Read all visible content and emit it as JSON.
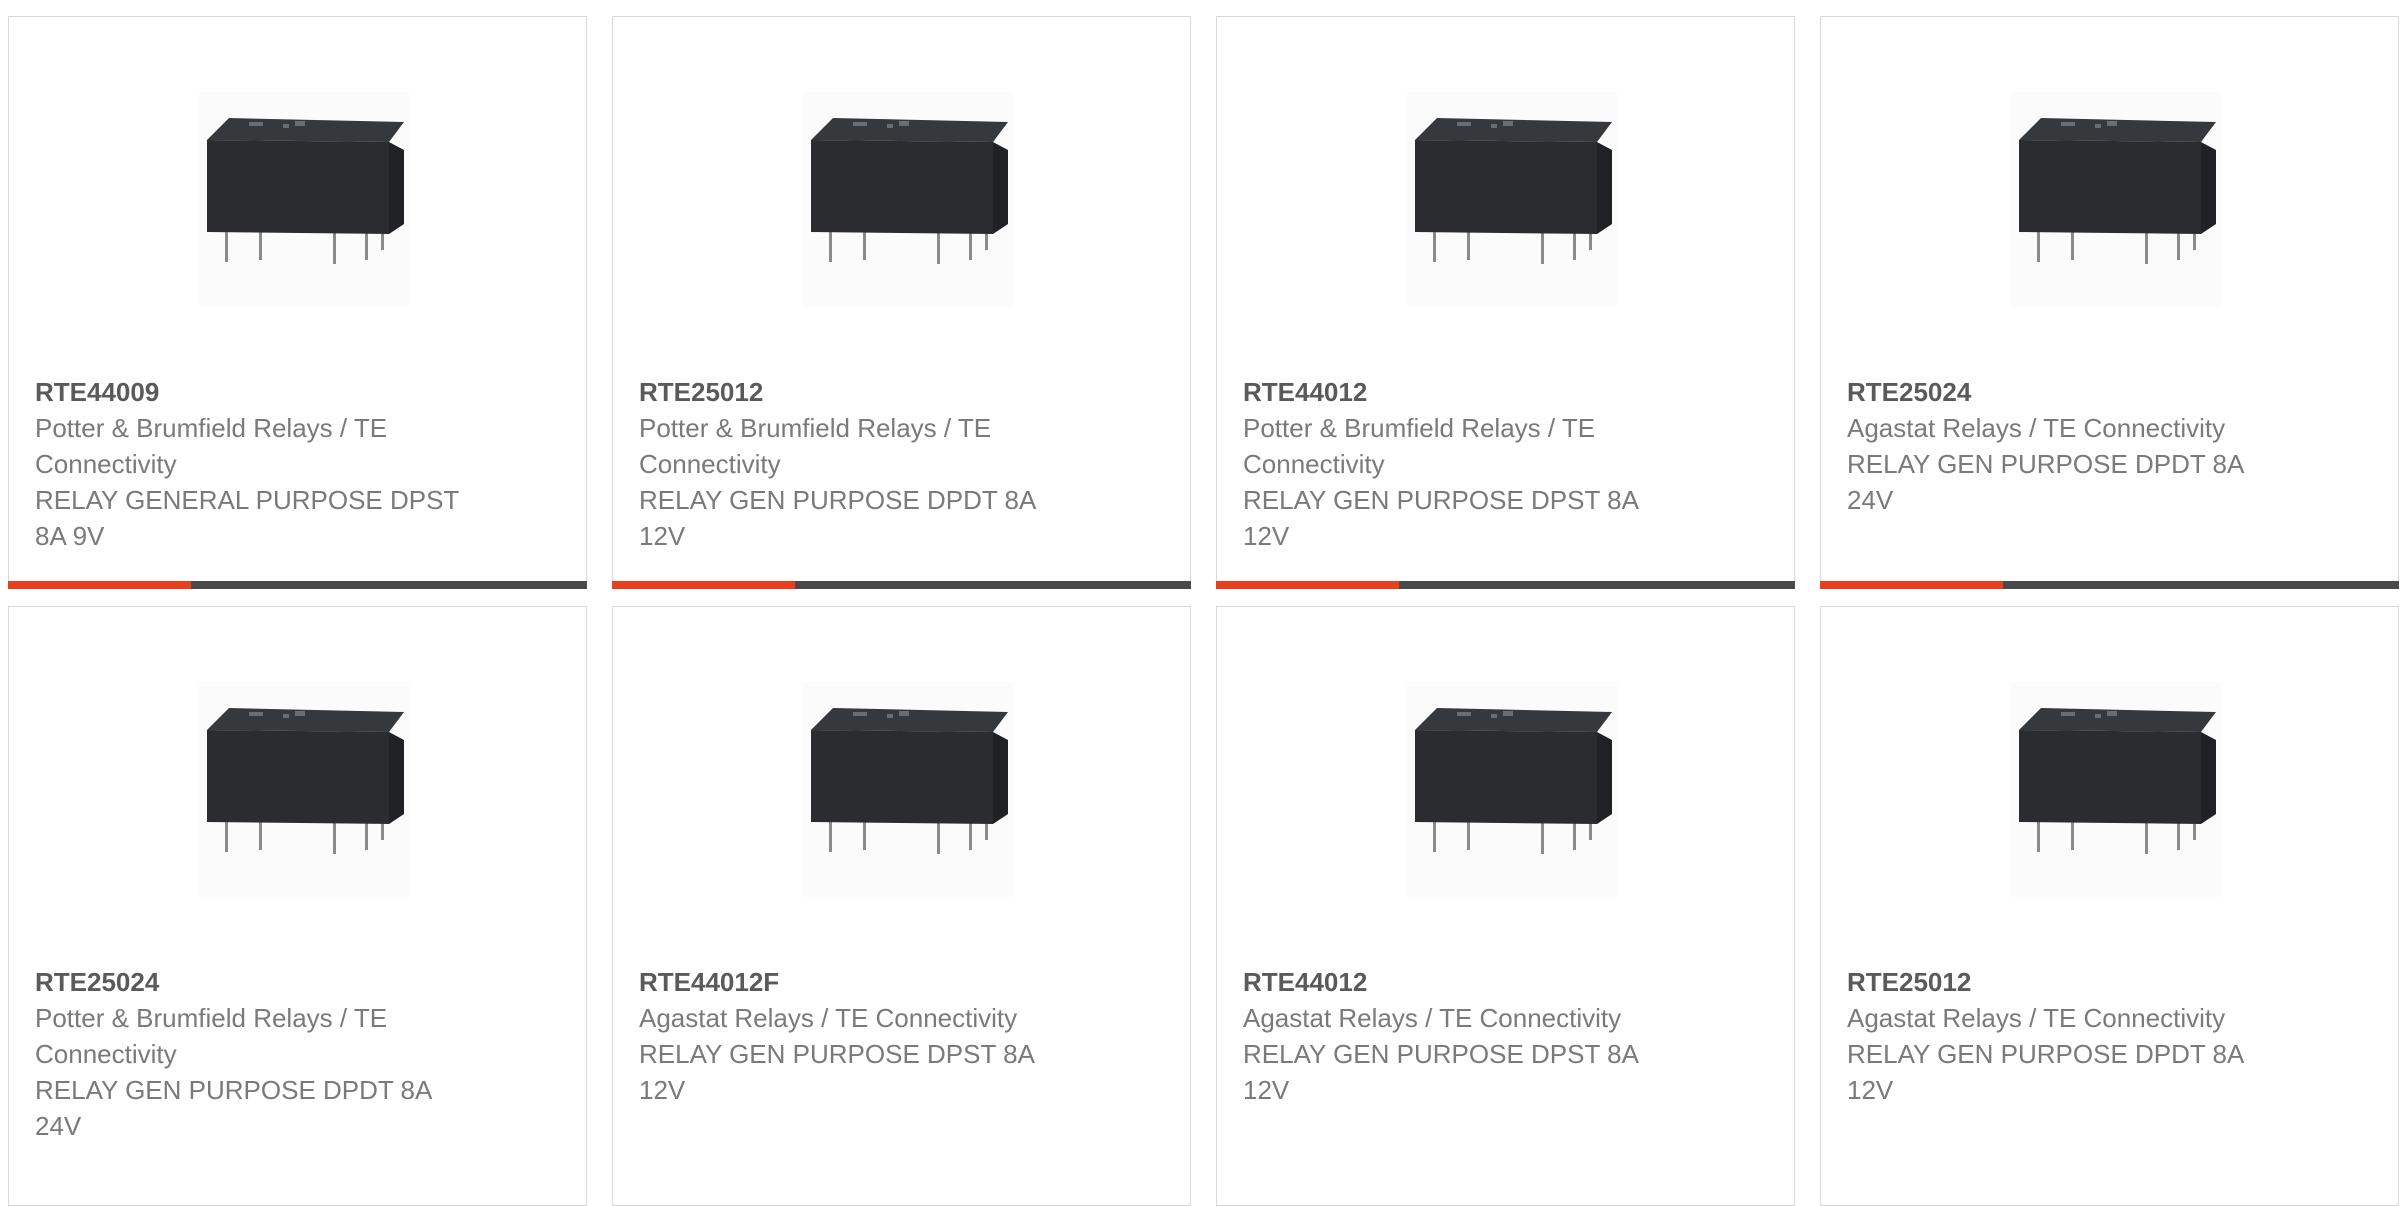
{
  "colors": {
    "accent": "#e8401c",
    "bar": "#4a4a4a",
    "border": "#d9d9d9",
    "title_text": "#5a5a5a",
    "body_text": "#7a7a7a"
  },
  "products": [
    {
      "part_number": "RTE44009",
      "manufacturer": "Potter & Brumfield Relays / TE Connectivity",
      "description": "RELAY GENERAL PURPOSE DPST 8A 9V",
      "image_icon": "relay-product-image"
    },
    {
      "part_number": "RTE25012",
      "manufacturer": "Potter & Brumfield Relays / TE Connectivity",
      "description": "RELAY GEN PURPOSE DPDT 8A 12V",
      "image_icon": "relay-product-image"
    },
    {
      "part_number": "RTE44012",
      "manufacturer": "Potter & Brumfield Relays / TE Connectivity",
      "description": "RELAY GEN PURPOSE DPST 8A 12V",
      "image_icon": "relay-product-image"
    },
    {
      "part_number": "RTE25024",
      "manufacturer": "Agastat Relays / TE Connectivity",
      "description": "RELAY GEN PURPOSE DPDT 8A 24V",
      "image_icon": "relay-product-image"
    },
    {
      "part_number": "RTE25024",
      "manufacturer": "Potter & Brumfield Relays / TE Connectivity",
      "description": "RELAY GEN PURPOSE DPDT 8A 24V",
      "image_icon": "relay-product-image"
    },
    {
      "part_number": "RTE44012F",
      "manufacturer": "Agastat Relays / TE Connectivity",
      "description": "RELAY GEN PURPOSE DPST 8A 12V",
      "image_icon": "relay-product-image"
    },
    {
      "part_number": "RTE44012",
      "manufacturer": "Agastat Relays / TE Connectivity",
      "description": "RELAY GEN PURPOSE DPST 8A 12V",
      "image_icon": "relay-product-image"
    },
    {
      "part_number": "RTE25012",
      "manufacturer": "Agastat Relays / TE Connectivity",
      "description": "RELAY GEN PURPOSE DPDT 8A 12V",
      "image_icon": "relay-product-image"
    }
  ]
}
